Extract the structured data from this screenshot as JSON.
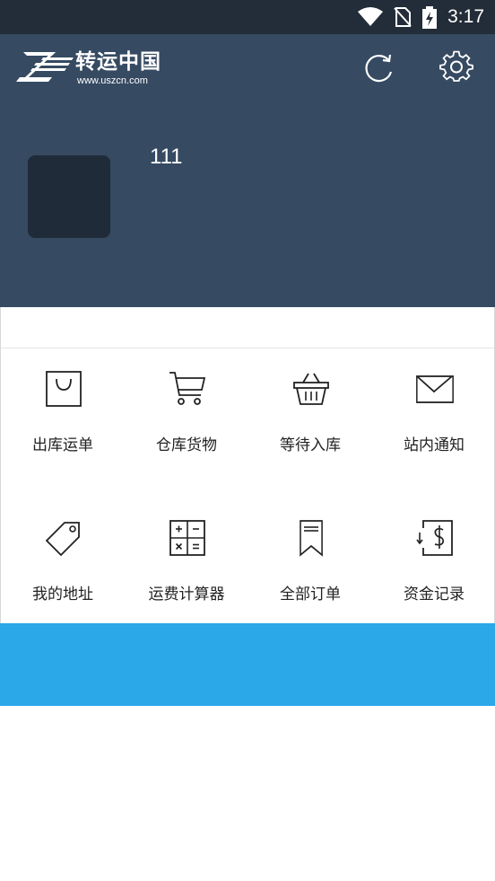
{
  "status_bar": {
    "time": "3:17",
    "icons": [
      "wifi-icon",
      "no-sim-icon",
      "battery-charging-icon"
    ]
  },
  "header": {
    "logo_title": "转运中国",
    "logo_url": "www.uszcn.com",
    "username": "111",
    "icons": [
      "refresh-icon",
      "gear-icon"
    ]
  },
  "menu": {
    "items": [
      {
        "label": "出库运单",
        "icon": "shopping-bag-icon"
      },
      {
        "label": "仓库货物",
        "icon": "shopping-cart-icon"
      },
      {
        "label": "等待入库",
        "icon": "basket-icon"
      },
      {
        "label": "站内通知",
        "icon": "envelope-icon"
      },
      {
        "label": "我的地址",
        "icon": "tag-icon"
      },
      {
        "label": "运费计算器",
        "icon": "calculator-icon"
      },
      {
        "label": "全部订单",
        "icon": "bookmark-icon"
      },
      {
        "label": "资金记录",
        "icon": "dollar-icon"
      }
    ]
  },
  "colors": {
    "status_bar_bg": "#232d39",
    "header_bg": "#364a62",
    "avatar_bg": "#1f2b39",
    "banner_bg": "#2aa8e8",
    "icon_stroke": "#222222"
  }
}
